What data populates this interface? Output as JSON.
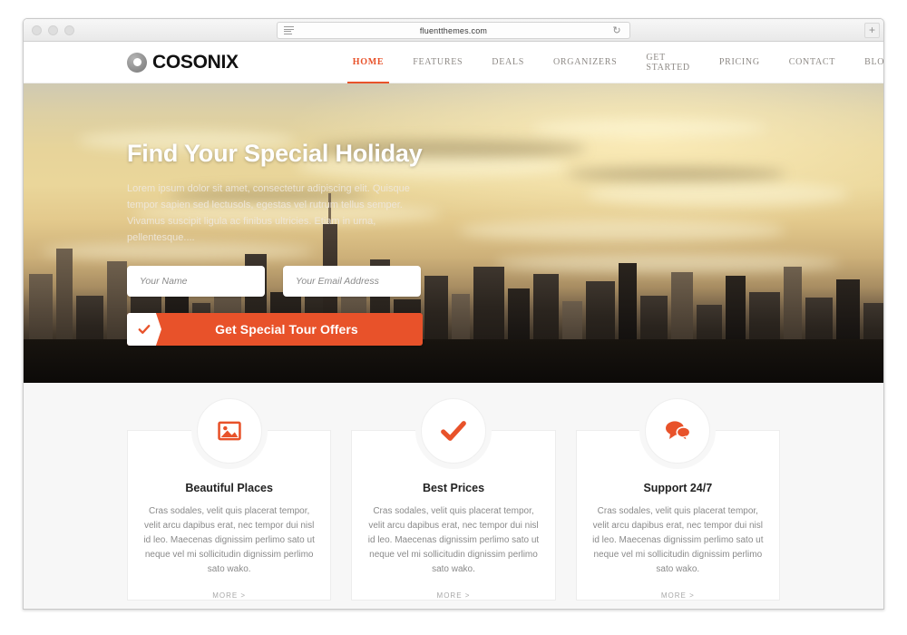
{
  "browser": {
    "url": "fluentthemes.com",
    "reader_icon": "reader-view-icon",
    "reload_icon": "reload-icon",
    "new_tab_label": "+",
    "traffic_lights": [
      "close",
      "minimize",
      "maximize"
    ]
  },
  "site": {
    "logo_text": "COSONIX",
    "logo_mark": "ring-logo-icon",
    "nav": [
      {
        "label": "HOME",
        "active": true
      },
      {
        "label": "FEATURES",
        "active": false
      },
      {
        "label": "DEALS",
        "active": false
      },
      {
        "label": "ORGANIZERS",
        "active": false
      },
      {
        "label": "GET STARTED",
        "active": false
      },
      {
        "label": "PRICING",
        "active": false
      },
      {
        "label": "CONTACT",
        "active": false
      },
      {
        "label": "BLOG",
        "active": false
      }
    ]
  },
  "hero": {
    "title": "Find Your Special Holiday",
    "subtitle": "Lorem ipsum dolor sit amet, consectetur adipiscing elit. Quisque tempor sapien sed lectusols, egestas vel rutrum tellus semper. Vivamus suscipit ligula ac finibus ultricies. Etiam in urna, pellentesque....",
    "form": {
      "name_placeholder": "Your Name",
      "name_value": "",
      "email_placeholder": "Your Email Address",
      "email_value": "",
      "cta_label": "Get Special Tour Offers",
      "cta_icon": "check-icon"
    }
  },
  "features": {
    "more_label": "MORE >",
    "cards": [
      {
        "icon": "image-icon",
        "title": "Beautiful Places",
        "text": "Cras sodales, velit quis placerat tempor, velit arcu dapibus erat, nec tempor dui nisl id leo. Maecenas dignissim perlimo sato ut neque vel mi sollicitudin dignissim perlimo sato wako."
      },
      {
        "icon": "check-icon",
        "title": "Best Prices",
        "text": "Cras sodales, velit quis placerat tempor, velit arcu dapibus erat, nec tempor dui nisl id leo. Maecenas dignissim perlimo sato ut neque vel mi sollicitudin dignissim perlimo sato wako."
      },
      {
        "icon": "chat-bubbles-icon",
        "title": "Support 24/7",
        "text": "Cras sodales, velit quis placerat tempor, velit arcu dapibus erat, nec tempor dui nisl id leo. Maecenas dignissim perlimo sato ut neque vel mi sollicitudin dignissim perlimo sato wako."
      }
    ]
  },
  "colors": {
    "accent": "#e8522a",
    "page_bg": "#f7f7f7",
    "nav_text": "#8e8a86",
    "heading": "#222222"
  }
}
